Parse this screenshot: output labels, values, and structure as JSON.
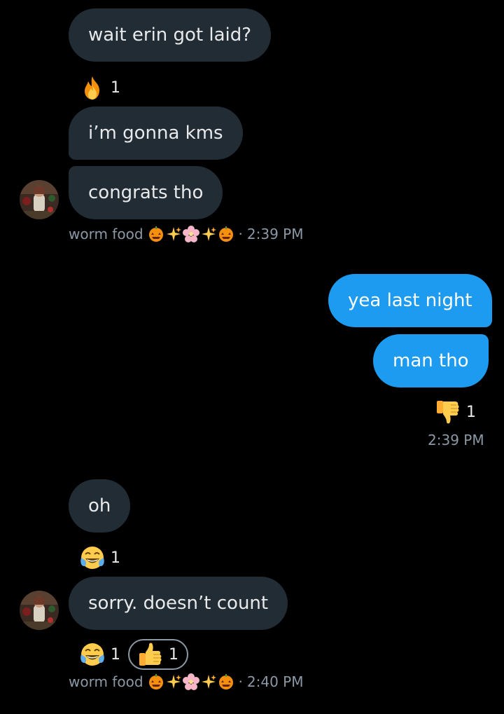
{
  "messages": {
    "m1": {
      "text": "wait erin got laid?"
    },
    "m1_reaction": {
      "emoji": "fire",
      "count": "1"
    },
    "m2": {
      "text": "i’m gonna kms"
    },
    "m3": {
      "text": "congrats tho"
    },
    "meta1": {
      "sender": "worm food",
      "sep": "·",
      "time": "2:39 PM"
    },
    "m4": {
      "text": "yea last night"
    },
    "m5": {
      "text": "man tho"
    },
    "m5_reaction": {
      "emoji": "thumbs-down",
      "count": "1"
    },
    "meta2": {
      "time": "2:39 PM"
    },
    "m6": {
      "text": "oh"
    },
    "m6_reaction": {
      "emoji": "face-with-tears-of-joy",
      "count": "1"
    },
    "m7": {
      "text": "sorry. doesn’t count"
    },
    "m7_reactions": [
      {
        "emoji": "face-with-tears-of-joy",
        "count": "1"
      },
      {
        "emoji": "thumbs-up",
        "count": "1",
        "selected": true
      }
    ],
    "meta3": {
      "sender": "worm food",
      "sep": "·",
      "time": "2:40 PM"
    }
  },
  "display_name_decoration": [
    "jack-o-lantern",
    "sparkles",
    "cherry-blossom",
    "sparkles",
    "jack-o-lantern"
  ],
  "colors": {
    "background": "#000000",
    "incoming_bubble": "#222c35",
    "outgoing_bubble": "#1d9bf0",
    "meta_text": "#8b98a5"
  }
}
